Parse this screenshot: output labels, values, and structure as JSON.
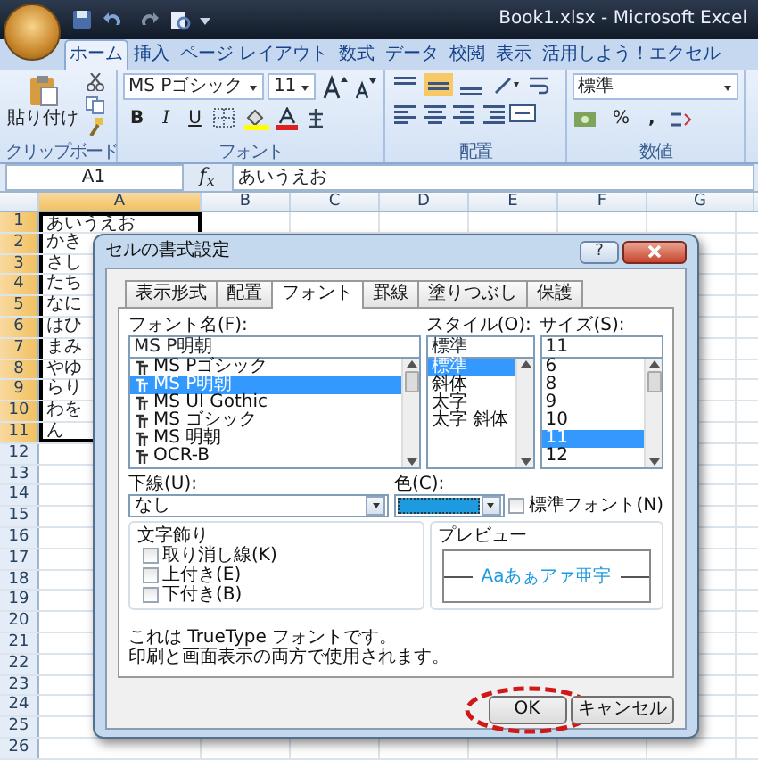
{
  "title_bar": {
    "title": "Book1.xlsx - Microsoft Excel"
  },
  "ribbon_tabs": [
    {
      "label": "ホーム",
      "selected": true
    },
    {
      "label": "挿入",
      "selected": false
    },
    {
      "label": "ページ レイアウト",
      "selected": false
    },
    {
      "label": "数式",
      "selected": false
    },
    {
      "label": "データ",
      "selected": false
    },
    {
      "label": "校閲",
      "selected": false
    },
    {
      "label": "表示",
      "selected": false
    },
    {
      "label": "活用しよう！エクセル",
      "selected": false
    }
  ],
  "ribbon": {
    "clipboard": {
      "paste_label": "貼り付け",
      "group_label": "クリップボード"
    },
    "font": {
      "font_name": "MS Pゴシック",
      "font_size": "11",
      "bold": "B",
      "italic": "I",
      "underline": "U",
      "group_label": "フォント"
    },
    "alignment": {
      "group_label": "配置"
    },
    "number": {
      "format": "標準",
      "percent": "%",
      "comma": ",",
      "group_label": "数値"
    }
  },
  "formula_bar": {
    "name_box": "A1",
    "fx": "f$_{x}$",
    "content": "あいうえお"
  },
  "sheet": {
    "columns": [
      {
        "label": "A",
        "selected": true
      },
      {
        "label": "B",
        "selected": false
      },
      {
        "label": "C",
        "selected": false
      },
      {
        "label": "D",
        "selected": false
      },
      {
        "label": "E",
        "selected": false
      },
      {
        "label": "F",
        "selected": false
      },
      {
        "label": "G",
        "selected": false
      }
    ],
    "rows": [
      {
        "number": "1",
        "cell_a": "あいうえお",
        "selected": true
      },
      {
        "number": "2",
        "cell_a": "かき",
        "selected": true
      },
      {
        "number": "3",
        "cell_a": "さし",
        "selected": true
      },
      {
        "number": "4",
        "cell_a": "たち",
        "selected": true
      },
      {
        "number": "5",
        "cell_a": "なに",
        "selected": true
      },
      {
        "number": "6",
        "cell_a": "はひ",
        "selected": true
      },
      {
        "number": "7",
        "cell_a": "まみ",
        "selected": true
      },
      {
        "number": "8",
        "cell_a": "やゆ",
        "selected": true
      },
      {
        "number": "9",
        "cell_a": "らり",
        "selected": true
      },
      {
        "number": "10",
        "cell_a": "わを",
        "selected": true
      },
      {
        "number": "11",
        "cell_a": "ん",
        "selected": true
      },
      {
        "number": "12",
        "selected": false
      },
      {
        "number": "13",
        "selected": false
      },
      {
        "number": "14",
        "selected": false
      },
      {
        "number": "15",
        "selected": false
      },
      {
        "number": "16",
        "selected": false
      },
      {
        "number": "17",
        "selected": false
      },
      {
        "number": "18",
        "selected": false
      },
      {
        "number": "19",
        "selected": false
      },
      {
        "number": "20",
        "selected": false
      },
      {
        "number": "21",
        "selected": false
      },
      {
        "number": "22",
        "selected": false
      },
      {
        "number": "23",
        "selected": false
      },
      {
        "number": "24",
        "selected": false
      },
      {
        "number": "25",
        "selected": false
      },
      {
        "number": "26",
        "selected": false
      }
    ]
  },
  "dialog": {
    "title": "セルの書式設定",
    "help": "?",
    "tabs": [
      {
        "label": "表示形式",
        "selected": false
      },
      {
        "label": "配置",
        "selected": false
      },
      {
        "label": "フォント",
        "selected": true
      },
      {
        "label": "罫線",
        "selected": false
      },
      {
        "label": "塗りつぶし",
        "selected": false
      },
      {
        "label": "保護",
        "selected": false
      }
    ],
    "font_name": {
      "label": "フォント名(F):",
      "value": "MS P明朝",
      "options": [
        {
          "label": "MS Pゴシック",
          "selected": false
        },
        {
          "label": "MS P明朝",
          "selected": true
        },
        {
          "label": "MS UI Gothic",
          "selected": false
        },
        {
          "label": "MS ゴシック",
          "selected": false
        },
        {
          "label": "MS 明朝",
          "selected": false
        },
        {
          "label": "OCR-B",
          "selected": false
        }
      ]
    },
    "style": {
      "label": "スタイル(O):",
      "value": "標準",
      "options": [
        {
          "label": "標準",
          "selected": true
        },
        {
          "label": "斜体",
          "selected": false
        },
        {
          "label": "太字",
          "selected": false
        },
        {
          "label": "太字 斜体",
          "selected": false
        }
      ]
    },
    "size": {
      "label": "サイズ(S):",
      "value": "11",
      "options": [
        {
          "label": "6",
          "selected": false
        },
        {
          "label": "8",
          "selected": false
        },
        {
          "label": "9",
          "selected": false
        },
        {
          "label": "10",
          "selected": false
        },
        {
          "label": "11",
          "selected": true
        },
        {
          "label": "12",
          "selected": false
        }
      ]
    },
    "underline": {
      "label": "下線(U):",
      "value": "なし"
    },
    "color": {
      "label": "色(C):",
      "color": "#1e9be0"
    },
    "normal_font": {
      "label": "標準フォント(N)",
      "checked": false
    },
    "effects": {
      "label": "文字飾り",
      "items": [
        {
          "label": "取り消し線(K)",
          "checked": false
        },
        {
          "label": "上付き(E)",
          "checked": false
        },
        {
          "label": "下付き(B)",
          "checked": false
        }
      ]
    },
    "preview": {
      "label": "プレビュー",
      "sample": "Aaあぁアァ亜宇"
    },
    "note": [
      "これは TrueType フォントです。",
      "印刷と画面表示の両方で使用されます。"
    ],
    "buttons": [
      {
        "label": "OK",
        "highlighted": true
      },
      {
        "label": "キャンセル",
        "highlighted": false
      }
    ]
  }
}
